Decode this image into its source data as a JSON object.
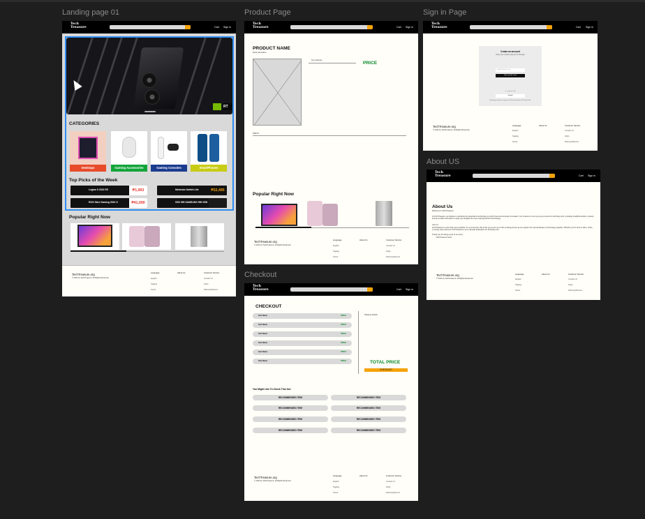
{
  "frames": {
    "landing": "Landing page 01",
    "product": "Product Page",
    "signin": "Sign in Page",
    "about": "About US",
    "checkout": "Checkout"
  },
  "nav": {
    "logo": "Tech Treasure",
    "cart": "Cart",
    "signin": "Sign in"
  },
  "landing": {
    "categories_title": "CATEGORIES",
    "categories": [
      "Desktops",
      "Gaming Accessories",
      "Gaming Consoles",
      "SmartPhones"
    ],
    "picks_title": "Top Picks of the Week",
    "picks": [
      {
        "name": "Legion 5 2022 R5",
        "price": "₱1,993"
      },
      {
        "name": "Nintendo Switch Lite",
        "price": "₱22,495"
      },
      {
        "name": "ROG Strix Gaming 2022 G",
        "price": "₱41,000"
      },
      {
        "name": "SSD 990 SAMSUNG 990 SSD",
        "price": ""
      }
    ],
    "popular_title": "Popular Right Now",
    "hero_badge": "RT"
  },
  "footer": {
    "brand": "TechTreasure.org",
    "copyright": "© 2024 by TechTreasure. All Rights Reserved.",
    "col1_title": "Language",
    "col1": [
      "English",
      "Tagalog",
      "Sub-E"
    ],
    "col2_title": "About Us",
    "col3_title": "Customer Service",
    "col3": [
      "Contact Us",
      "FAQs",
      "Warranty/Returns"
    ]
  },
  "product": {
    "name": "PRODUCT NAME",
    "extra": "Extra information",
    "key_features": "Key Features",
    "price": "PRICE",
    "specs": "SPECS",
    "popular_title": "Popular Right Now"
  },
  "signin": {
    "title": "Create an account",
    "subtitle": "Enter your email to sign up for this app",
    "email_placeholder": "email@domain.com",
    "button": "Sign up with email",
    "or": "or continue with",
    "google": "Google",
    "terms": "By clicking continue, you agree to our Terms of Service and Privacy Policy"
  },
  "about": {
    "title": "About Us",
    "subtitle": "Welcome to TechTreasure!",
    "para1": "At TechTreasure, we believe in unlocking the potential of technology to enrich lives and empower innovation. Our mission is to be your go-to source for all things tech, providing insightful articles, reviews, and up-to-date information to help you navigate the ever-evolving world of technology.",
    "join": "Join Us",
    "para2": "TechTreasure is more than just a website; it's a community. We invite you to join us on this exciting journey as we explore the vast landscape of technology together. Whether you're here to learn, share, or simply stay informed, TechTreasure is your ultimate destination for all things tech.",
    "thanks": "Thank you for being a part of our story.",
    "sign": "- TechTreasure Team"
  },
  "checkout": {
    "title": "CHECKOUT",
    "items": [
      {
        "name": "Item Name",
        "price": "PRICE"
      },
      {
        "name": "Item Name",
        "price": "PRICE"
      },
      {
        "name": "Item Name",
        "price": "PRICE"
      },
      {
        "name": "Item Name",
        "price": "PRICE"
      },
      {
        "name": "Item Name",
        "price": "PRICE"
      },
      {
        "name": "Item Name",
        "price": "PRICE"
      }
    ],
    "shipping": "Shipping Details",
    "total": "TOTAL PRICE",
    "button": "CHECKOUT",
    "rec_title": "You Might Like To Check This Out",
    "rec_label": "RECOMMENDED ITEM"
  },
  "colors": {
    "accent": "#f5a30a",
    "selection": "#2d8cf0",
    "price_green": "#0a8a2a",
    "canvas": "#1e1e1e"
  }
}
